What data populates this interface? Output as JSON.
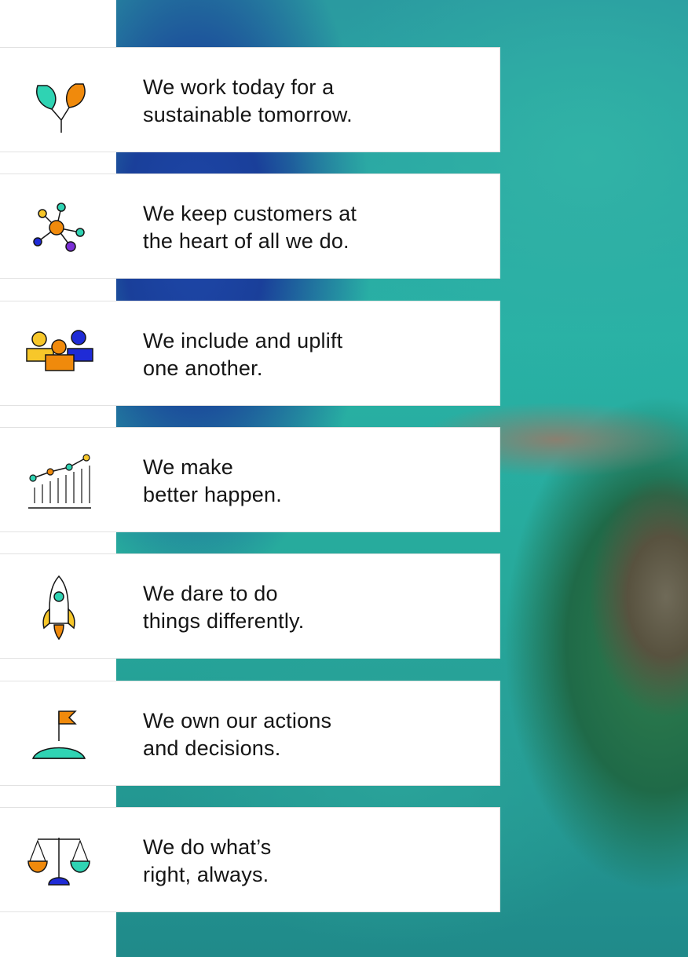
{
  "values": [
    {
      "line1": "We work today for a",
      "line2": "sustainable tomorrow.",
      "icon": "sprout-icon"
    },
    {
      "line1": "We keep customers at",
      "line2": "the heart of all we do.",
      "icon": "network-nodes-icon"
    },
    {
      "line1": "We include and uplift",
      "line2": "one another.",
      "icon": "people-group-icon"
    },
    {
      "line1": "We make",
      "line2": "better happen.",
      "icon": "growth-chart-icon"
    },
    {
      "line1": "We dare to do",
      "line2": "things differently.",
      "icon": "rocket-icon"
    },
    {
      "line1": "We own our actions",
      "line2": "and decisions.",
      "icon": "flag-hill-icon"
    },
    {
      "line1": "We do what’s",
      "line2": "right, always.",
      "icon": "balance-scale-icon"
    }
  ],
  "colors": {
    "teal": "#2fd3b3",
    "orange": "#f08a0c",
    "blue": "#1f2bd6",
    "yellow": "#f7c72a",
    "purple": "#7b2fd6",
    "ink": "#151515"
  }
}
